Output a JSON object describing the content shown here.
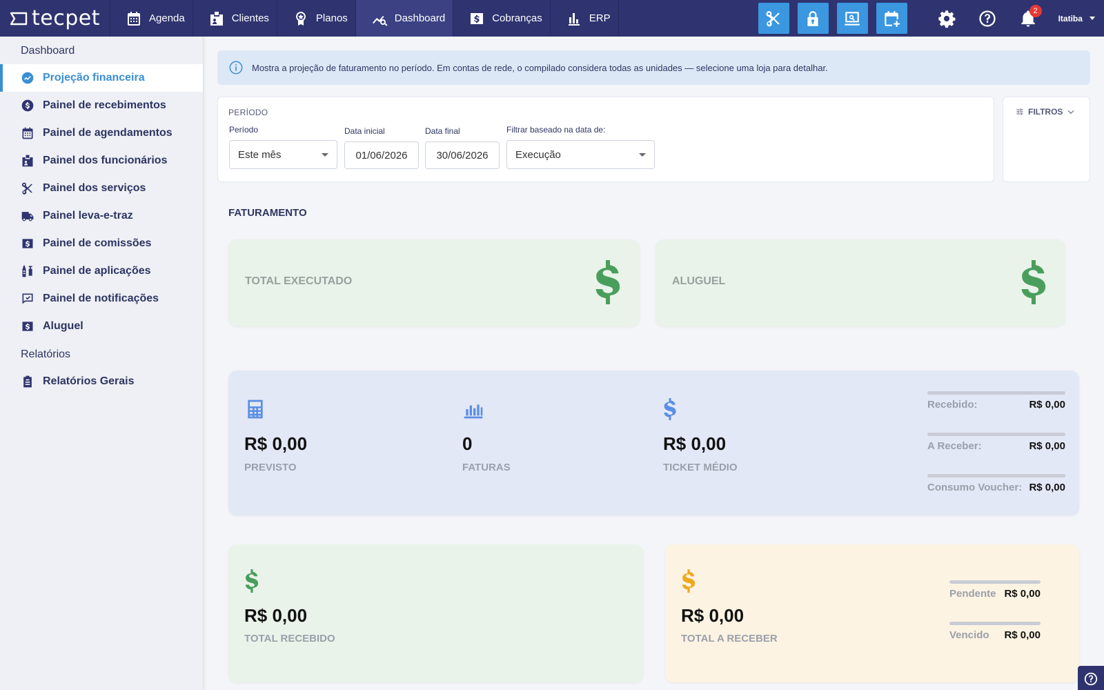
{
  "app": {
    "logo_text": "tecpet"
  },
  "topnav": [
    {
      "label": "Agenda",
      "icon": "calendar-icon"
    },
    {
      "label": "Clientes",
      "icon": "id-badge-icon"
    },
    {
      "label": "Planos",
      "icon": "award-icon"
    },
    {
      "label": "Dashboard",
      "icon": "chart-search-icon",
      "active": true
    },
    {
      "label": "Cobranças",
      "icon": "dollar-bill-icon"
    },
    {
      "label": "ERP",
      "icon": "bar-chart-icon"
    }
  ],
  "quick_actions": [
    "scissors-icon",
    "lock-icon",
    "monitor-search-icon",
    "calendar-add-icon"
  ],
  "notifications": {
    "count": "2"
  },
  "user": {
    "store": "Itatiba"
  },
  "sidebar": {
    "section_dashboard": "Dashboard",
    "items": [
      {
        "label": "Projeção financeira",
        "active": true
      },
      {
        "label": "Painel de recebimentos"
      },
      {
        "label": "Painel de agendamentos"
      },
      {
        "label": "Painel dos funcionários"
      },
      {
        "label": "Painel dos serviços"
      },
      {
        "label": "Painel leva-e-traz"
      },
      {
        "label": "Painel de comissões"
      },
      {
        "label": "Painel de aplicações"
      },
      {
        "label": "Painel de notificações"
      },
      {
        "label": "Aluguel"
      }
    ],
    "section_reports": "Relatórios",
    "report_items": [
      {
        "label": "Relatórios Gerais"
      }
    ]
  },
  "info_banner": "Mostra a projeção de faturamento no período. Em contas de rede, o compilado considera todas as unidades — selecione uma loja para detalhar.",
  "filters": {
    "title": "PERÍODO",
    "period_label": "Período",
    "period_value": "Este mês",
    "start_label": "Data inicial",
    "start_value": "01/06/2026",
    "end_label": "Data final",
    "end_value": "30/06/2026",
    "basis_label": "Filtrar baseado na data de:",
    "basis_value": "Execução",
    "filtros_label": "FILTROS"
  },
  "billing": {
    "section_title": "FATURAMENTO",
    "total_executado": "TOTAL EXECUTADO",
    "aluguel": "ALUGUEL"
  },
  "summary": {
    "previsto_value": "R$ 0,00",
    "previsto_label": "PREVISTO",
    "faturas_value": "0",
    "faturas_label": "FATURAS",
    "ticket_value": "R$ 0,00",
    "ticket_label": "TICKET MÉDIO",
    "recebido_label": "Recebido:",
    "recebido_value": "R$ 0,00",
    "a_receber_label": "A Receber:",
    "a_receber_value": "R$ 0,00",
    "voucher_label": "Consumo Voucher:",
    "voucher_value": "R$ 0,00"
  },
  "received": {
    "value": "R$ 0,00",
    "label": "TOTAL RECEBIDO"
  },
  "receivable": {
    "value": "R$ 0,00",
    "label": "TOTAL A RECEBER",
    "pendente_label": "Pendente",
    "pendente_value": "R$ 0,00",
    "vencido_label": "Vencido",
    "vencido_value": "R$ 0,00"
  },
  "colors": {
    "topbar": "#2f3470",
    "accent": "#3a97e0",
    "green": "#4a9e5c",
    "orange": "#f0a81e",
    "blue_icon": "#5b8ee6"
  }
}
